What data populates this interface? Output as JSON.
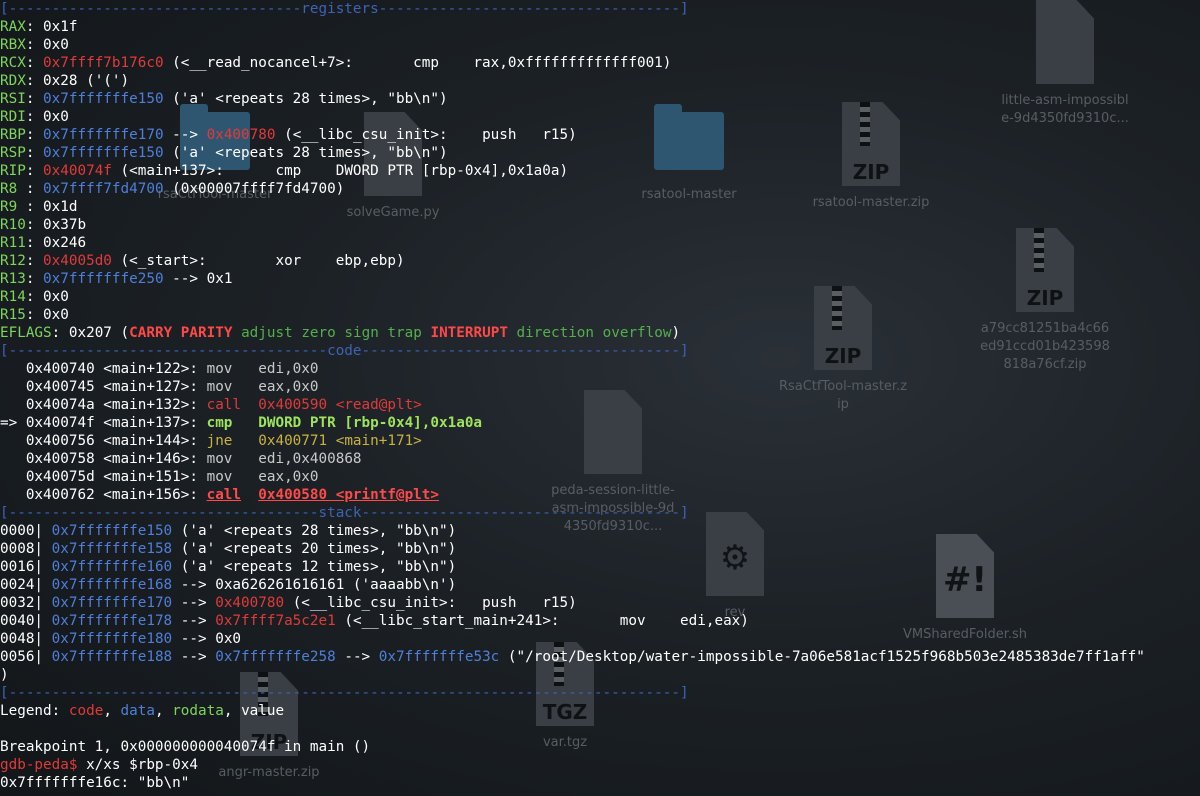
{
  "desktop": {
    "icons": [
      {
        "label": "little-asm-impossible-9d4350fd9310c...",
        "type": "doc",
        "badge": ""
      },
      {
        "label": "rsatool-master.zip",
        "type": "zip",
        "badge": "ZIP"
      },
      {
        "label": "rsatool-master",
        "type": "folder",
        "badge": ""
      },
      {
        "label": "solveGame.py",
        "type": "doc",
        "badge": ""
      },
      {
        "label": "rsaCtfTool-master",
        "type": "folder",
        "badge": ""
      },
      {
        "label": "a79cc81251ba4c66ed91ccd01b423598818a76cf.zip",
        "type": "zip",
        "badge": "ZIP"
      },
      {
        "label": "RsaCtfTool-master.zip",
        "type": "zip",
        "badge": "ZIP"
      },
      {
        "label": "peda-session-little-asm-impossible-9d4350fd9310c...",
        "type": "doc",
        "badge": ""
      },
      {
        "label": "VMSharedFolder.sh",
        "type": "script",
        "badge": "#!"
      },
      {
        "label": "var.tgz",
        "type": "zip",
        "badge": "TGZ"
      },
      {
        "label": "angr-master.zip",
        "type": "zip",
        "badge": "ZIP"
      },
      {
        "label": "rev",
        "type": "gear",
        "badge": ""
      }
    ]
  },
  "terminal": {
    "sep_registers": "[----------------------------------registers-----------------------------------]",
    "registers": [
      {
        "name": "RAX",
        "value": "0x1f",
        "vcolor": "white",
        "rest": []
      },
      {
        "name": "RBX",
        "value": "0x0",
        "vcolor": "white",
        "rest": []
      },
      {
        "name": "RCX",
        "value": "0x7ffff7b176c0",
        "vcolor": "red",
        "rest": [
          {
            "t": " (<__read_nocancel+7>:       cmp    rax,0xfffffffffffff001)",
            "c": "white"
          }
        ]
      },
      {
        "name": "RDX",
        "value": "0x28 ('(')",
        "vcolor": "white",
        "rest": []
      },
      {
        "name": "RSI",
        "value": "0x7fffffffe150",
        "vcolor": "blue",
        "rest": [
          {
            "t": " ('a' <repeats 28 times>, \"bb\\n\")",
            "c": "white"
          }
        ]
      },
      {
        "name": "RDI",
        "value": "0x0",
        "vcolor": "white",
        "rest": []
      },
      {
        "name": "RBP",
        "value": "0x7fffffffe170",
        "vcolor": "blue",
        "rest": [
          {
            "t": " --> ",
            "c": "white"
          },
          {
            "t": "0x400780",
            "c": "red"
          },
          {
            "t": " (<__libc_csu_init>:    push   r15)",
            "c": "white"
          }
        ]
      },
      {
        "name": "RSP",
        "value": "0x7fffffffe150",
        "vcolor": "blue",
        "rest": [
          {
            "t": " ('a' <repeats 28 times>, \"bb\\n\")",
            "c": "white"
          }
        ]
      },
      {
        "name": "RIP",
        "value": "0x40074f",
        "vcolor": "red",
        "rest": [
          {
            "t": " (<main+137>:      cmp    DWORD PTR [rbp-0x4],0x1a0a)",
            "c": "white"
          }
        ]
      },
      {
        "name": "R8 ",
        "value": "0x7ffff7fd4700",
        "vcolor": "blue",
        "rest": [
          {
            "t": " (0x00007ffff7fd4700)",
            "c": "white"
          }
        ]
      },
      {
        "name": "R9 ",
        "value": "0x1d",
        "vcolor": "white",
        "rest": []
      },
      {
        "name": "R10",
        "value": "0x37b",
        "vcolor": "white",
        "rest": []
      },
      {
        "name": "R11",
        "value": "0x246",
        "vcolor": "white",
        "rest": []
      },
      {
        "name": "R12",
        "value": "0x4005d0",
        "vcolor": "red",
        "rest": [
          {
            "t": " (<_start>:        xor    ebp,ebp)",
            "c": "white"
          }
        ]
      },
      {
        "name": "R13",
        "value": "0x7fffffffe250",
        "vcolor": "blue",
        "rest": [
          {
            "t": " --> 0x1",
            "c": "white"
          }
        ]
      },
      {
        "name": "R14",
        "value": "0x0",
        "vcolor": "white",
        "rest": []
      },
      {
        "name": "R15",
        "value": "0x0",
        "vcolor": "white",
        "rest": []
      }
    ],
    "eflags": {
      "name": "EFLAGS",
      "value": "0x207",
      "flags": [
        {
          "t": "CARRY",
          "set": true
        },
        {
          "t": "PARITY",
          "set": true
        },
        {
          "t": "adjust",
          "set": false
        },
        {
          "t": "zero",
          "set": false
        },
        {
          "t": "sign",
          "set": false
        },
        {
          "t": "trap",
          "set": false
        },
        {
          "t": "INTERRUPT",
          "set": true
        },
        {
          "t": "direction",
          "set": false
        },
        {
          "t": "overflow",
          "set": false
        }
      ]
    },
    "sep_code": "[-------------------------------------code-------------------------------------]",
    "code": [
      {
        "prefix": "   ",
        "addr": "0x400740 <main+122>:",
        "mn": "mov",
        "op": "edi,0x0",
        "style": "normal"
      },
      {
        "prefix": "   ",
        "addr": "0x400745 <main+127>:",
        "mn": "mov",
        "op": "eax,0x0",
        "style": "normal"
      },
      {
        "prefix": "   ",
        "addr": "0x40074a <main+132>:",
        "mn": "call",
        "op": "0x400590 <read@plt>",
        "style": "call"
      },
      {
        "prefix": "=> ",
        "addr": "0x40074f <main+137>:",
        "mn": "cmp",
        "op": "DWORD PTR [rbp-0x4],0x1a0a",
        "style": "current"
      },
      {
        "prefix": "   ",
        "addr": "0x400756 <main+144>:",
        "mn": "jne",
        "op": "0x400771 <main+171>",
        "style": "jump"
      },
      {
        "prefix": "   ",
        "addr": "0x400758 <main+146>:",
        "mn": "mov",
        "op": "edi,0x400868",
        "style": "normal"
      },
      {
        "prefix": "   ",
        "addr": "0x40075d <main+151>:",
        "mn": "mov",
        "op": "eax,0x0",
        "style": "normal"
      },
      {
        "prefix": "   ",
        "addr": "0x400762 <main+156>:",
        "mn": "call",
        "op": "0x400580 <printf@plt>",
        "style": "callbold"
      }
    ],
    "sep_stack": "[------------------------------------stack-------------------------------------]",
    "stack": [
      {
        "off": "0000|",
        "addr": "0x7fffffffe150",
        "rest": [
          {
            "t": " ('a' <repeats 28 times>, \"bb\\n\")",
            "c": "white"
          }
        ]
      },
      {
        "off": "0008|",
        "addr": "0x7fffffffe158",
        "rest": [
          {
            "t": " ('a' <repeats 20 times>, \"bb\\n\")",
            "c": "white"
          }
        ]
      },
      {
        "off": "0016|",
        "addr": "0x7fffffffe160",
        "rest": [
          {
            "t": " ('a' <repeats 12 times>, \"bb\\n\")",
            "c": "white"
          }
        ]
      },
      {
        "off": "0024|",
        "addr": "0x7fffffffe168",
        "rest": [
          {
            "t": " --> 0xa626261616161 ('aaaabb\\n')",
            "c": "white"
          }
        ]
      },
      {
        "off": "0032|",
        "addr": "0x7fffffffe170",
        "rest": [
          {
            "t": " --> ",
            "c": "white"
          },
          {
            "t": "0x400780",
            "c": "red"
          },
          {
            "t": " (<__libc_csu_init>:   push   r15)",
            "c": "white"
          }
        ]
      },
      {
        "off": "0040|",
        "addr": "0x7fffffffe178",
        "rest": [
          {
            "t": " --> ",
            "c": "white"
          },
          {
            "t": "0x7ffff7a5c2e1",
            "c": "red"
          },
          {
            "t": " (<__libc_start_main+241>:       mov    edi,eax)",
            "c": "white"
          }
        ]
      },
      {
        "off": "0048|",
        "addr": "0x7fffffffe180",
        "rest": [
          {
            "t": " --> 0x0",
            "c": "white"
          }
        ]
      },
      {
        "off": "0056|",
        "addr": "0x7fffffffe188",
        "rest": [
          {
            "t": " --> ",
            "c": "white"
          },
          {
            "t": "0x7fffffffe258",
            "c": "blue"
          },
          {
            "t": " --> ",
            "c": "white"
          },
          {
            "t": "0x7fffffffe53c",
            "c": "blue"
          },
          {
            "t": " (\"/root/Desktop/water-impossible-7a06e581acf1525f968b503e2485383de7ff1aff\"",
            "c": "white"
          }
        ]
      }
    ],
    "stack_close": ")",
    "sep_end": "[------------------------------------------------------------------------------]",
    "legend": {
      "label": "Legend: ",
      "code": "code",
      "data": "data",
      "rodata": "rodata",
      "value": "value"
    },
    "breakpoint": "Breakpoint 1, 0x000000000040074f in main ()",
    "prompt": "gdb-peda$",
    "command": " x/xs $rbp-0x4",
    "result": "0x7fffffffe16c: \"bb\\n\""
  }
}
